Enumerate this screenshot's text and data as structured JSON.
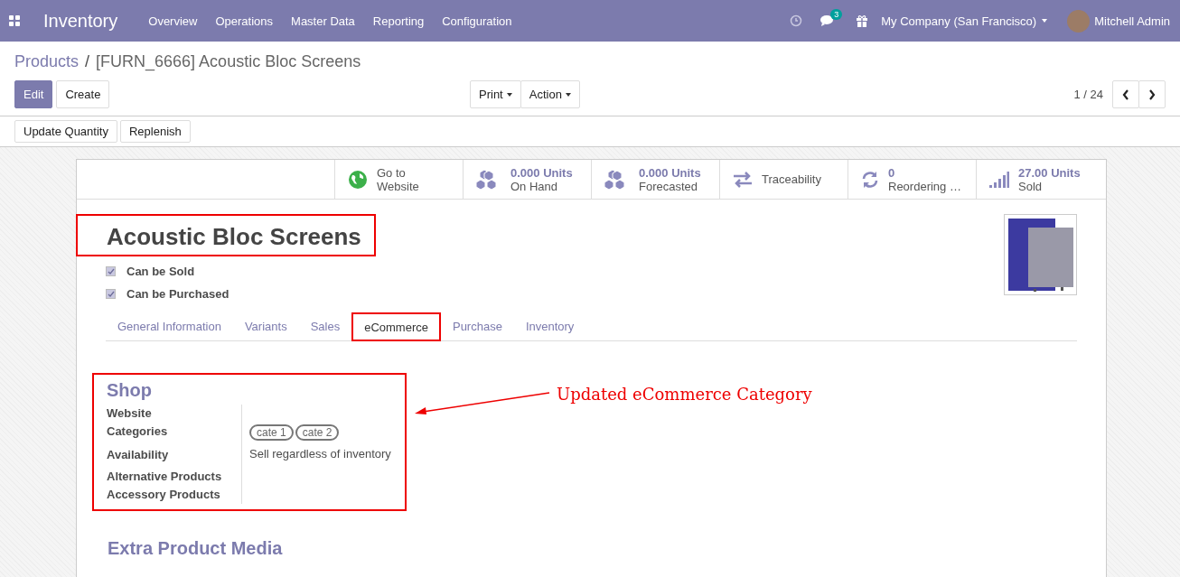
{
  "navbar": {
    "app_name": "Inventory",
    "menu": [
      "Overview",
      "Operations",
      "Master Data",
      "Reporting",
      "Configuration"
    ],
    "message_count": "3",
    "company": "My Company (San Francisco)",
    "user": "Mitchell Admin"
  },
  "breadcrumb": {
    "parent": "Products",
    "separator": "/",
    "current": "[FURN_6666] Acoustic Bloc Screens"
  },
  "actions": {
    "edit": "Edit",
    "create": "Create",
    "dropdowns": [
      "Print",
      "Action"
    ],
    "pager": "1 / 24"
  },
  "secondary_buttons": [
    "Update Quantity",
    "Replenish"
  ],
  "stat_buttons": [
    {
      "kind": "globe",
      "value": "Go to",
      "label": "Website",
      "emphasis": false
    },
    {
      "kind": "cubes",
      "value": "0.000 Units",
      "label": "On Hand",
      "emphasis": true
    },
    {
      "kind": "cubes",
      "value": "0.000 Units",
      "label": "Forecasted",
      "emphasis": true
    },
    {
      "kind": "arrows",
      "value": "Traceability",
      "emphasis": false
    },
    {
      "kind": "refresh",
      "value": "0",
      "label": "Reordering …",
      "emphasis": true
    },
    {
      "kind": "bars",
      "value": "27.00 Units",
      "label": "Sold",
      "emphasis": true
    }
  ],
  "product": {
    "name": "Acoustic Bloc Screens",
    "highlighted": true,
    "options": [
      {
        "label": "Can be Sold",
        "checked": true
      },
      {
        "label": "Can be Purchased",
        "checked": true
      }
    ]
  },
  "tabs": [
    {
      "label": "General Information",
      "selected": false,
      "highlighted": false
    },
    {
      "label": "Variants",
      "selected": false,
      "highlighted": false
    },
    {
      "label": "Sales",
      "selected": false,
      "highlighted": false
    },
    {
      "label": "eCommerce",
      "selected": true,
      "highlighted": true
    },
    {
      "label": "Purchase",
      "selected": false,
      "highlighted": false
    },
    {
      "label": "Inventory",
      "selected": false,
      "highlighted": false
    }
  ],
  "shop": {
    "title": "Shop",
    "highlighted": true,
    "fields": [
      {
        "label": "Website",
        "kind": "text"
      },
      {
        "label": "Categories",
        "kind": "tags",
        "tags": [
          "cate 1",
          "cate 2"
        ]
      },
      {
        "label": "Availability",
        "kind": "text",
        "value": "Sell regardless of inventory"
      },
      {
        "label": "Alternative Products",
        "kind": "text"
      },
      {
        "label": "Accessory Products",
        "kind": "text"
      }
    ]
  },
  "annotation": {
    "text": "Updated eCommerce Category"
  },
  "next_section": {
    "title": "Extra Product Media"
  }
}
